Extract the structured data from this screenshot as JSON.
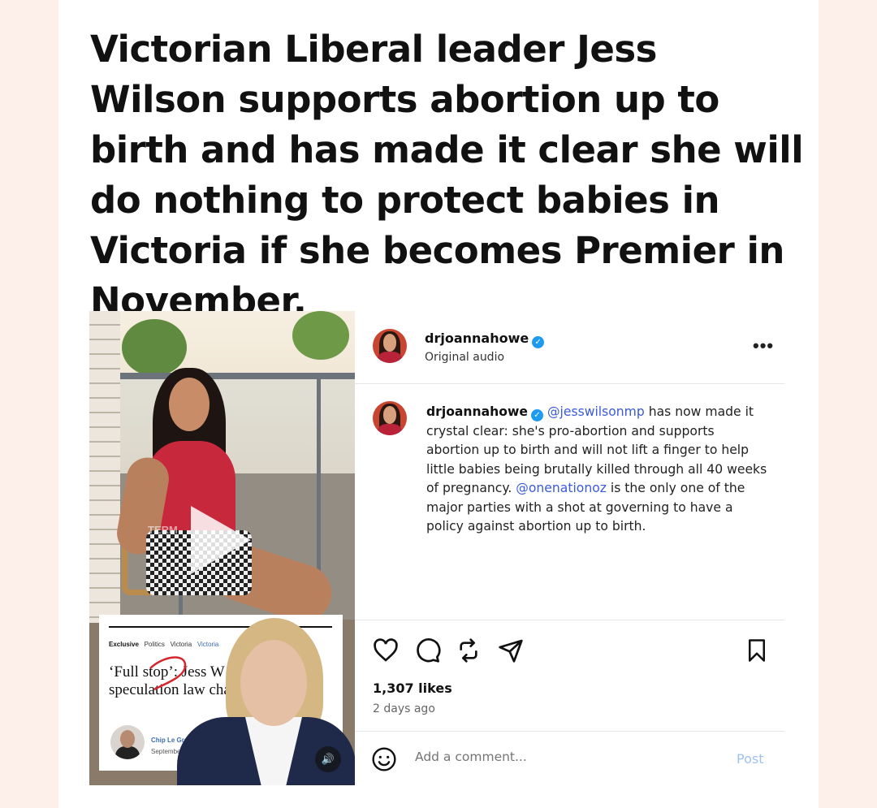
{
  "headline": "Victorian Liberal leader Jess Wilson supports abortion up to birth and has made it clear she will do nothing to protect babies in Victoria if she becomes Premier in November.",
  "post": {
    "username": "drjoannahowe",
    "audio": "Original audio",
    "more_label": "•••",
    "caption": {
      "username": "drjoannahowe",
      "mention1": "@jesswilsonmp",
      "text1": " has now made it crystal clear: she's pro-abortion and supports abortion up to birth and will not lift a finger to help little babies being brutally killed through all 40 weeks of pregnancy.",
      "mention2": "@onenationoz",
      "text2": " is the only one of the major parties with a shot at governing to have a policy against abortion up to birth."
    },
    "likes": "1,307 likes",
    "time_ago": "2 days ago",
    "comment_placeholder": "Add a comment...",
    "post_label": "Post"
  },
  "media": {
    "overlay_text": "TERM",
    "news": {
      "tag_exclusive": "Exclusive",
      "tag_politics": "Politics",
      "tag_victoria": "Victoria",
      "tag_victoria2": "Victoria",
      "headline": "‘Full stop’: Jess W down speculation law change",
      "author": "Chip Le Grand",
      "date": "September"
    }
  },
  "colors": {
    "mention": "#3a5bd9",
    "verified": "#1d9bf0",
    "post_button": "#9ec3ef"
  },
  "icons": [
    "heart-icon",
    "comment-icon",
    "repost-icon",
    "share-icon",
    "bookmark-icon",
    "emoji-icon",
    "sound-icon",
    "play-icon",
    "verified-icon"
  ]
}
